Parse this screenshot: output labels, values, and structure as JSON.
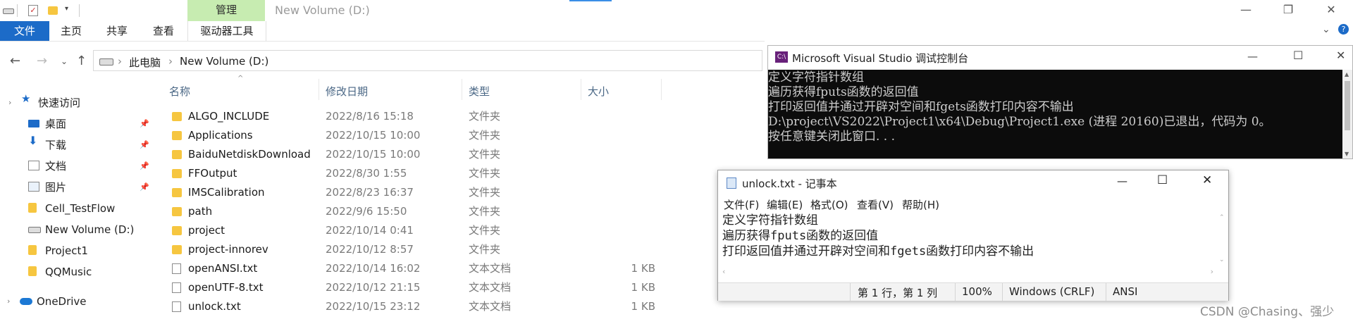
{
  "explorer": {
    "quick_access_toolbar": [
      "drive-icon",
      "properties-icon",
      "folder-icon",
      "customize-icon"
    ],
    "contextual_tab": "管理",
    "window_title": "New Volume (D:)",
    "ribbon_tabs": [
      "文件",
      "主页",
      "共享",
      "查看",
      "驱动器工具"
    ],
    "breadcrumb": [
      "此电脑",
      "New Volume (D:)"
    ],
    "nav_pane": [
      {
        "label": "快速访问",
        "icon": "star-icon",
        "pinned": false
      },
      {
        "label": "桌面",
        "icon": "desktop-icon",
        "pinned": true
      },
      {
        "label": "下载",
        "icon": "download-icon",
        "pinned": true
      },
      {
        "label": "文档",
        "icon": "document-icon",
        "pinned": true
      },
      {
        "label": "图片",
        "icon": "picture-icon",
        "pinned": true
      },
      {
        "label": "Cell_TestFlow",
        "icon": "folder-icon",
        "pinned": false
      },
      {
        "label": "New Volume (D:)",
        "icon": "drive-icon",
        "pinned": false
      },
      {
        "label": "Project1",
        "icon": "folder-icon",
        "pinned": false
      },
      {
        "label": "QQMusic",
        "icon": "folder-icon",
        "pinned": false
      },
      {
        "label": "OneDrive",
        "icon": "cloud-icon",
        "pinned": false
      }
    ],
    "columns": {
      "name": "名称",
      "date": "修改日期",
      "type": "类型",
      "size": "大小"
    },
    "files": [
      {
        "name": "ALGO_INCLUDE",
        "date": "2022/8/16 15:18",
        "type": "文件夹",
        "size": "",
        "kind": "folder"
      },
      {
        "name": "Applications",
        "date": "2022/10/15 10:00",
        "type": "文件夹",
        "size": "",
        "kind": "folder"
      },
      {
        "name": "BaiduNetdiskDownload",
        "date": "2022/10/15 10:00",
        "type": "文件夹",
        "size": "",
        "kind": "folder"
      },
      {
        "name": "FFOutput",
        "date": "2022/8/30 1:55",
        "type": "文件夹",
        "size": "",
        "kind": "folder"
      },
      {
        "name": "IMSCalibration",
        "date": "2022/8/23 16:37",
        "type": "文件夹",
        "size": "",
        "kind": "folder"
      },
      {
        "name": "path",
        "date": "2022/9/6 15:50",
        "type": "文件夹",
        "size": "",
        "kind": "folder"
      },
      {
        "name": "project",
        "date": "2022/10/14 0:41",
        "type": "文件夹",
        "size": "",
        "kind": "folder"
      },
      {
        "name": "project-innorev",
        "date": "2022/10/12 8:57",
        "type": "文件夹",
        "size": "",
        "kind": "folder"
      },
      {
        "name": "openANSI.txt",
        "date": "2022/10/14 16:02",
        "type": "文本文档",
        "size": "1 KB",
        "kind": "text"
      },
      {
        "name": "openUTF-8.txt",
        "date": "2022/10/12 21:15",
        "type": "文本文档",
        "size": "1 KB",
        "kind": "text"
      },
      {
        "name": "unlock.txt",
        "date": "2022/10/15 23:12",
        "type": "文本文档",
        "size": "1 KB",
        "kind": "text"
      }
    ]
  },
  "console": {
    "title": "Microsoft Visual Studio 调试控制台",
    "lines": [
      "定义字符指针数组",
      "遍历获得fputs函数的返回值",
      "打印返回值并通过开辟对空间和fgets函数打印内容不输出",
      "D:\\project\\VS2022\\Project1\\x64\\Debug\\Project1.exe (进程 20160)已退出，代码为 0。",
      "按任意键关闭此窗口. . ."
    ]
  },
  "notepad": {
    "title": "unlock.txt - 记事本",
    "menu": [
      "文件(F)",
      "编辑(E)",
      "格式(O)",
      "查看(V)",
      "帮助(H)"
    ],
    "text": "定义字符指针数组\n遍历获得fputs函数的返回值\n打印返回值并通过开辟对空间和fgets函数打印内容不输出",
    "status": {
      "position": "第 1 行，第 1 列",
      "zoom": "100%",
      "eol": "Windows (CRLF)",
      "encoding": "ANSI"
    }
  },
  "watermark": "CSDN @Chasing、强少",
  "colors": {
    "ribbon_file_tab": "#1c6bc8",
    "manage_tab": "#c7ecb1",
    "console_bg": "#0c0c0c",
    "folder": "#f6c640"
  }
}
